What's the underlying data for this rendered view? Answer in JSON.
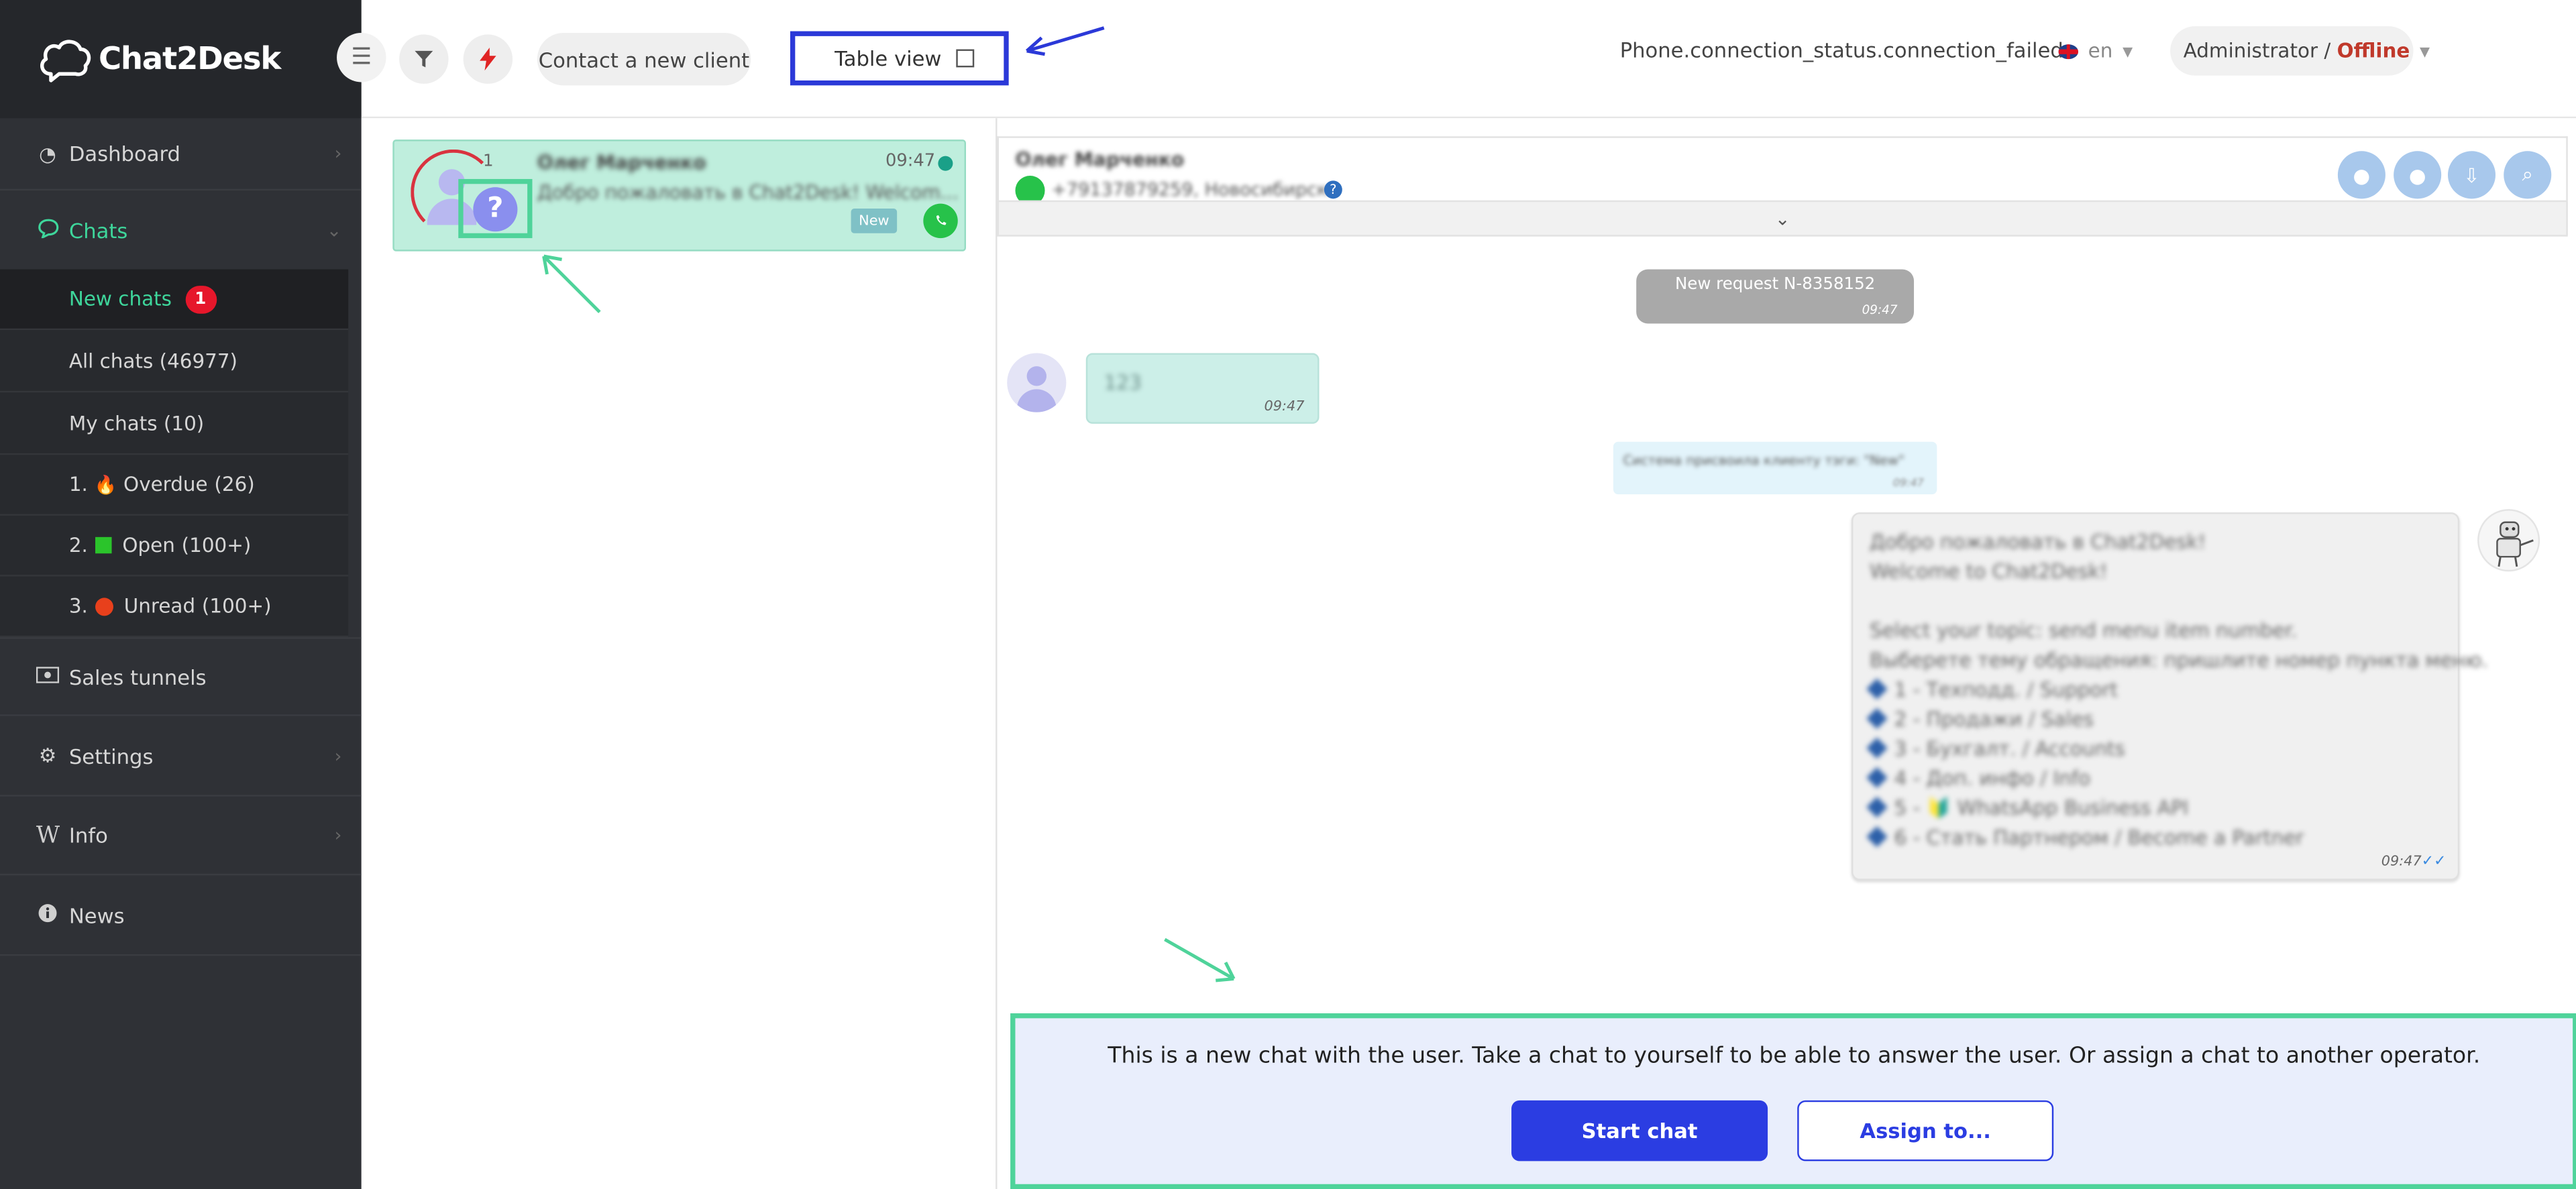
{
  "app": {
    "logo_text": "Chat2Desk"
  },
  "sidebar": {
    "items": [
      {
        "label": "Dashboard",
        "icon": "dashboard-icon"
      },
      {
        "label": "Chats",
        "icon": "chat-icon"
      },
      {
        "label": "Sales tunnels",
        "icon": "money-icon"
      },
      {
        "label": "Settings",
        "icon": "gear-icon"
      },
      {
        "label": "Info",
        "icon": "wikipedia-icon"
      },
      {
        "label": "News",
        "icon": "info-circle-icon"
      }
    ],
    "chats_sub": [
      {
        "label": "New chats",
        "badge": "1"
      },
      {
        "label": "All chats (46977)"
      },
      {
        "label": "My chats (10)"
      },
      {
        "prefix": "1.",
        "label": "Overdue",
        "count": "(26)",
        "icon": "fire-icon"
      },
      {
        "prefix": "2.",
        "label": "Open",
        "count": "(100+)",
        "icon": "green-square-icon"
      },
      {
        "prefix": "3.",
        "label": "Unread",
        "count": "(100+)",
        "icon": "red-circle-icon"
      }
    ]
  },
  "header": {
    "contact_button": "Contact a new client",
    "table_view_label": "Table view",
    "connection_status": "Phone.connection_status.connection_failed",
    "language": "en",
    "user_name": "Administrator",
    "user_sep": " / ",
    "user_status": "Offline"
  },
  "chat_list": {
    "cards": [
      {
        "unread": "1",
        "name": "Олег Марченко",
        "preview": "Добро пожаловать в Chat2Desk! Welcom...",
        "time": "09:47",
        "badge": "New"
      }
    ]
  },
  "conversation": {
    "client_name": "Олег Марченко",
    "client_phone": "+79137879259, Новосибирск",
    "messages": {
      "system": {
        "text": "New request N-8358152",
        "time": "09:47"
      },
      "incoming": {
        "text": "123",
        "time": "09:47"
      },
      "note": {
        "text": "Система присвоила клиенту тэги: \"New\"",
        "time": "09:47"
      },
      "outgoing": {
        "lines": [
          "Добро пожаловать в Chat2Desk!",
          "Welcome to Chat2Desk!",
          "",
          "Select your topic: send menu item number.",
          "Выберете тему обращения: пришлите номер пункта меню."
        ],
        "menu": [
          "1 - Техподд. / Support",
          "2 - Продажи / Sales",
          "3 - Бухгалт. / Accounts",
          "4 - Доп. инфо / Info",
          "5 - 🔰 WhatsApp Business API",
          "6 - Стать Партнером / Become a Partner"
        ],
        "time": "09:47"
      }
    },
    "new_chat_notice": "This is a new chat with the user. Take a chat to yourself to be able to answer the user. Or assign a chat to another operator.",
    "start_button": "Start chat",
    "assign_button": "Assign to..."
  },
  "colors": {
    "accent_green": "#3ed69b",
    "primary_blue": "#2b3de2",
    "annotation_blue": "#2b39d8",
    "annotation_green": "#4fd39a",
    "offline_red": "#c0392b"
  }
}
